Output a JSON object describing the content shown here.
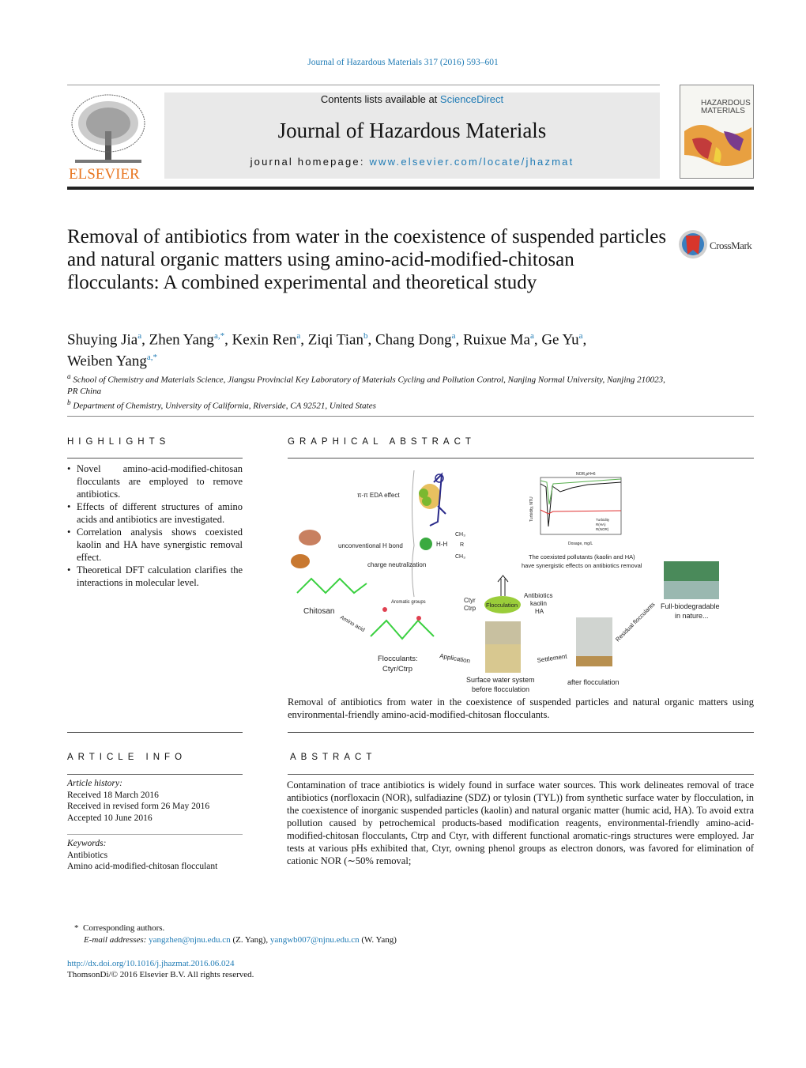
{
  "journal_line": "Journal of Hazardous Materials 317 (2016) 593–601",
  "header": {
    "contents_prefix": "Contents lists available at ",
    "contents_link": "ScienceDirect",
    "journal_title": "Journal of Hazardous Materials",
    "homepage_prefix": "journal homepage: ",
    "homepage_link": "www.elsevier.com/locate/jhazmat",
    "publisher_logo": "ELSEVIER",
    "cover_title": "HAZARDOUS MATERIALS",
    "crossmark": "CrossMark"
  },
  "title": "Removal of antibiotics from water in the coexistence of suspended particles and natural organic matters using amino-acid-modified-chitosan flocculants: A combined experimental and theoretical study",
  "authors": [
    {
      "name": "Shuying Jia",
      "sup": "a"
    },
    {
      "name": "Zhen Yang",
      "sup": "a,*"
    },
    {
      "name": "Kexin Ren",
      "sup": "a"
    },
    {
      "name": "Ziqi Tian",
      "sup": "b"
    },
    {
      "name": "Chang Dong",
      "sup": "a"
    },
    {
      "name": "Ruixue Ma",
      "sup": "a"
    },
    {
      "name": "Ge Yu",
      "sup": "a"
    },
    {
      "name": "Weiben Yang",
      "sup": "a,*"
    }
  ],
  "affiliations": [
    {
      "sup": "a",
      "text": "School of Chemistry and Materials Science, Jiangsu Provincial Key Laboratory of Materials Cycling and Pollution Control, Nanjing Normal University, Nanjing 210023, PR China"
    },
    {
      "sup": "b",
      "text": "Department of Chemistry, University of California, Riverside, CA 92521, United States"
    }
  ],
  "highlights": {
    "heading": "HIGHLIGHTS",
    "items": [
      "Novel amino-acid-modified-chitosan flocculants are employed to remove antibiotics.",
      "Effects of different structures of amino acids and antibiotics are investigated.",
      "Correlation analysis shows coexisted kaolin and HA have synergistic removal effect.",
      "Theoretical DFT calculation clarifies the interactions in molecular level."
    ]
  },
  "graphical_abstract": {
    "heading": "GRAPHICAL ABSTRACT",
    "labels": {
      "pi": "π-π EDA effect",
      "hbond": "unconventional H bond",
      "charge": "charge neutralization",
      "ch3a": "CH₃",
      "ch3b": "CH₃",
      "r": "R",
      "hh": "H-H",
      "chitosan": "Chitosan",
      "amino": "Amino acid",
      "aromatic": "Aromatic groups",
      "flocculants": "Flocculants:",
      "ctyr": "Ctyr/Ctrp",
      "application": "Application",
      "ctyr2": "Ctyr",
      "ctrp2": "Ctrp",
      "flocculation": "Flocculation",
      "antibiotics": "Antibiotics",
      "kaolin": "kaolin",
      "ha": "HA",
      "surface1": "Surface water system",
      "surface2": "before flocculation",
      "settlement": "Settlement",
      "after": "after flocculation",
      "residual": "Residual flocculants",
      "bio1": "Full-biodegradable",
      "bio2": "in nature...",
      "coex1": "The coexisted pollutants (kaolin and HA)",
      "coex2": "have synergistic effects on antibiotics removal",
      "chart_title": "NOR,pH=6",
      "chart_xlabel": "Dosage, mg/L",
      "chart_ylabel": "Turbidity, NTU",
      "legend": [
        "Turbidity",
        "R(HA)",
        "R(NOR)"
      ]
    },
    "caption": "Removal of antibiotics from water in the coexistence of suspended particles and natural organic matters using environmental-friendly amino-acid-modified-chitosan flocculants."
  },
  "article_info": {
    "heading": "ARTICLE INFO",
    "history_label": "Article history:",
    "history": [
      "Received 18 March 2016",
      "Received in revised form 26 May 2016",
      "Accepted 10 June 2016"
    ],
    "keywords_label": "Keywords:",
    "keywords": [
      "Antibiotics",
      "Amino acid-modified-chitosan flocculant"
    ]
  },
  "abstract": {
    "heading": "ABSTRACT",
    "text": "Contamination of trace antibiotics is widely found in surface water sources. This work delineates removal of trace antibiotics (norfloxacin (NOR), sulfadiazine (SDZ) or tylosin (TYL)) from synthetic surface water by flocculation, in the coexistence of inorganic suspended particles (kaolin) and natural organic matter (humic acid, HA). To avoid extra pollution caused by petrochemical products-based modification reagents, environmental-friendly amino-acid-modified-chitosan flocculants, Ctrp and Ctyr, with different functional aromatic-rings structures were employed. Jar tests at various pHs exhibited that, Ctyr, owning phenol groups as electron donors, was favored for elimination of cationic NOR (∼50% removal;"
  },
  "footnotes": {
    "corr": "Corresponding authors.",
    "email_label": "E-mail addresses: ",
    "email1": "yangzhen@njnu.edu.cn",
    "email1_who": " (Z. Yang), ",
    "email2": "yangwb007@njnu.edu.cn",
    "email2_who": " (W. Yang)",
    "doi": "http://dx.doi.org/10.1016/j.jhazmat.2016.06.024",
    "copyright": "ThomsonDi/© 2016 Elsevier B.V. All rights reserved."
  },
  "colors": {
    "link": "#1f7bb5",
    "elsevier_orange": "#e87722",
    "band": "#e9e9e9"
  }
}
